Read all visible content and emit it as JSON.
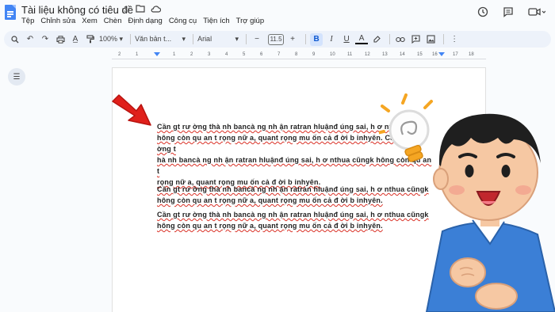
{
  "doc": {
    "title": "Tài liệu không có tiêu đề",
    "menu": [
      "Tệp",
      "Chỉnh sửa",
      "Xem",
      "Chèn",
      "Định dạng",
      "Công cụ",
      "Tiện ích",
      "Trợ giúp"
    ]
  },
  "toolbar": {
    "zoom": "100%",
    "style": "Văn bản t...",
    "font": "Arial",
    "font_size": "11.5",
    "minus": "−",
    "plus": "+",
    "bold": "B",
    "italic": "I",
    "underline": "U",
    "text_color": "A"
  },
  "ruler": {
    "ticks": [
      "2",
      "1",
      "1",
      "2",
      "3",
      "4",
      "5",
      "6",
      "7",
      "8",
      "9",
      "10",
      "11",
      "12",
      "13",
      "14",
      "15",
      "16",
      "17",
      "18"
    ]
  },
  "body": {
    "p1_l1": "Cần gt rư ờng thà nh bancà ng nh ận ratran hluậnđ úng sai, h ơ nthua cũngk",
    "p1_l2": "hông còn qu an t rọng nữ a, quant rọng mu ốn cả đ ời b inhyên. Cần gt rư ờng t",
    "p1_l3": "hà nh bancà ng nh ận ratran hluậnđ úng sai, h ơ nthua cũngk hông còn qu an t",
    "p1_l4": "rọng nữ a, quant rọng mu ốn cả đ ời b inhyên.",
    "p2_l1": "Cần gt rư ờng thà nh bancà ng nh ận ratran hluậnđ úng sai, h ơ nthua cũngk",
    "p2_l2": "hông còn qu an t rọng nữ a, quant rọng mu ốn cả đ ời b inhyên.",
    "p3_l1": "Cần gt rư ờng thà nh bancà ng nh ận ratran hluậnđ úng sai, h ơ nthua cũngk",
    "p3_l2": "hông còn qu an t rọng nữ a, quant rọng mu ốn cả đ ời b inhyên."
  },
  "colors": {
    "accent": "#4285f4",
    "arrow": "#e0201b",
    "shirt": "#3b7fd6"
  }
}
